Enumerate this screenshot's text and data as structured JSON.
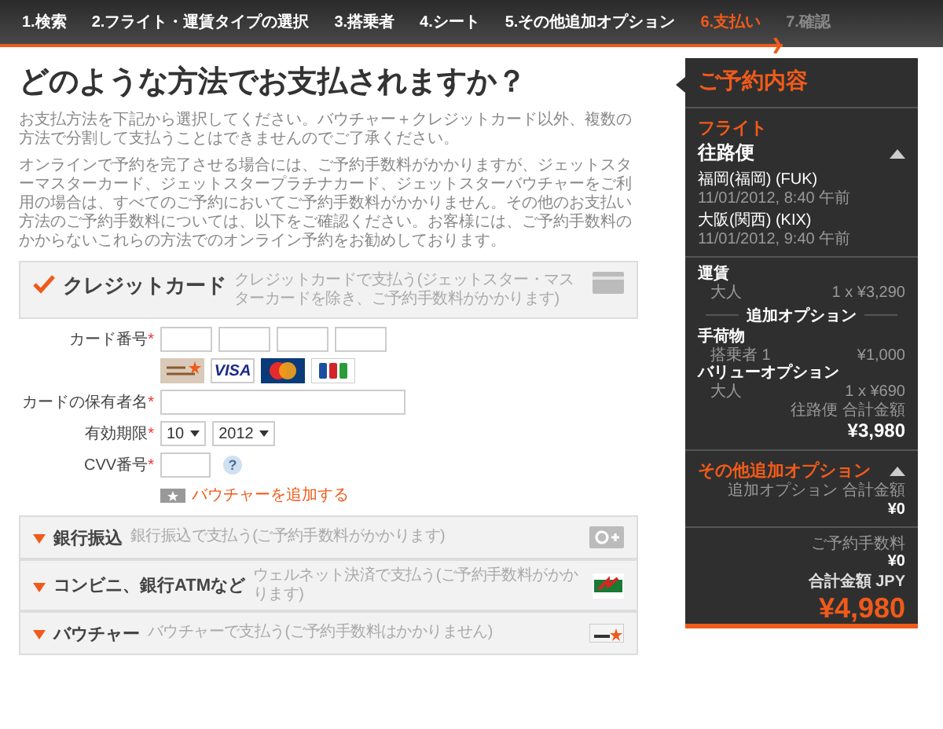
{
  "steps": [
    {
      "label": "1.検索",
      "selected": false,
      "disabled": false
    },
    {
      "label": "2.フライト・運賃タイプの選択",
      "selected": false,
      "disabled": false
    },
    {
      "label": "3.搭乗者",
      "selected": false,
      "disabled": false
    },
    {
      "label": "4.シート",
      "selected": false,
      "disabled": false
    },
    {
      "label": "5.その他追加オプション",
      "selected": false,
      "disabled": false
    },
    {
      "label": "6.支払い",
      "selected": true,
      "disabled": false
    },
    {
      "label": "7.確認",
      "selected": false,
      "disabled": true
    }
  ],
  "title": "どのような方法でお支払されますか？",
  "paragraphs": [
    "お支払方法を下記から選択してください。バウチャー＋クレジットカード以外、複数の方法で分割して支払うことはできませんのでご了承ください。",
    "オンラインで予約を完了させる場合には、ご予約手数料がかかりますが、ジェットスターマスターカード、ジェットスタープラチナカード、ジェットスターバウチャーをご利用の場合は、すべてのご予約においてご予約手数料がかかりません。その他のお支払い方法のご予約手数料については、以下をご確認ください。お客様には、ご予約手数料のかからないこれらの方法でのオンライン予約をお勧めしております。"
  ],
  "payment_methods": [
    {
      "name": "クレジットカード",
      "description": "クレジットカードで支払う(ジェットスター・マスターカードを除き、ご予約手数料がかかります)",
      "expanded": true,
      "kind": "card"
    },
    {
      "name": "銀行振込",
      "description": "銀行振込で支払う(ご予約手数料がかかります)",
      "expanded": false,
      "kind": "bank"
    },
    {
      "name": "コンビニ、銀行ATMなど",
      "description": "ウェルネット決済で支払う(ご予約手数料がかかります)",
      "expanded": false,
      "kind": "wellnet"
    },
    {
      "name": "バウチャー",
      "description": "バウチャーで支払う(ご予約手数料はかかりません)",
      "expanded": false,
      "kind": "voucher"
    }
  ],
  "card_form": {
    "card_number": {
      "label": "カード番号",
      "mark": "*"
    },
    "card_logos": [
      {
        "kind": "jetstar"
      },
      {
        "kind": "visa",
        "label": "VISA"
      },
      {
        "kind": "mastercard"
      },
      {
        "kind": "jcb"
      }
    ],
    "holder": {
      "label": "カードの保有者名",
      "mark": "*"
    },
    "expiry": {
      "label": "有効期限",
      "mark": "*",
      "month": "10",
      "year": "2012"
    },
    "cvv": {
      "label": "CVV番号",
      "mark": "*",
      "help": "?"
    },
    "voucher_link": "バウチャーを追加する"
  },
  "summary": {
    "title": "ご予約内容",
    "flight": {
      "heading": "フライト",
      "direction": "往路便",
      "expanded": true,
      "segments": [
        {
          "place": "福岡(福岡) (FUK)",
          "time": "11/01/2012, 8:40 午前"
        },
        {
          "place": "大阪(関西) (KIX)",
          "time": "11/01/2012, 9:40 午前"
        }
      ]
    },
    "fare": {
      "heading": "運賃",
      "label": "大人",
      "value": "1 x ¥3,290"
    },
    "options_divider": "追加オプション",
    "options": [
      {
        "heading": "手荷物",
        "label": "搭乗者 1",
        "value": "¥1,000"
      },
      {
        "heading": "バリューオプション",
        "label": "大人",
        "value": "1 x ¥690"
      }
    ],
    "subtotal_label": "往路便 合計金額",
    "subtotal": "¥3,980"
  },
  "other_options": {
    "heading": "その他追加オプション",
    "expanded": true,
    "total_label": "追加オプション 合計金額",
    "total": "¥0"
  },
  "fees": {
    "fee_label": "ご予約手数料",
    "fee": "¥0",
    "grand_label": "合計金額 JPY",
    "grand_total": "¥4,980"
  }
}
